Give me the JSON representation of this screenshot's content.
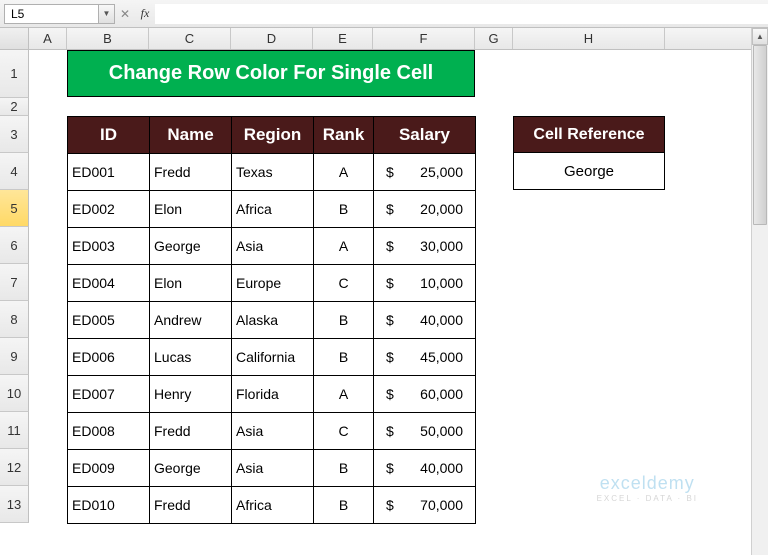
{
  "namebox": "L5",
  "formula": "",
  "columns": [
    "A",
    "B",
    "C",
    "D",
    "E",
    "F",
    "G",
    "H"
  ],
  "rows": [
    "1",
    "2",
    "3",
    "4",
    "5",
    "6",
    "7",
    "8",
    "9",
    "10",
    "11",
    "12",
    "13"
  ],
  "active_row": "5",
  "title": "Change Row Color For Single Cell",
  "headers": {
    "id": "ID",
    "name": "Name",
    "region": "Region",
    "rank": "Rank",
    "salary": "Salary"
  },
  "data": [
    {
      "id": "ED001",
      "name": "Fredd",
      "region": "Texas",
      "rank": "A",
      "salary": "25,000"
    },
    {
      "id": "ED002",
      "name": "Elon",
      "region": "Africa",
      "rank": "B",
      "salary": "20,000"
    },
    {
      "id": "ED003",
      "name": "George",
      "region": "Asia",
      "rank": "A",
      "salary": "30,000"
    },
    {
      "id": "ED004",
      "name": "Elon",
      "region": "Europe",
      "rank": "C",
      "salary": "10,000"
    },
    {
      "id": "ED005",
      "name": "Andrew",
      "region": "Alaska",
      "rank": "B",
      "salary": "40,000"
    },
    {
      "id": "ED006",
      "name": "Lucas",
      "region": "California",
      "rank": "B",
      "salary": "45,000"
    },
    {
      "id": "ED007",
      "name": "Henry",
      "region": "Florida",
      "rank": "A",
      "salary": "60,000"
    },
    {
      "id": "ED008",
      "name": "Fredd",
      "region": "Asia",
      "rank": "C",
      "salary": "50,000"
    },
    {
      "id": "ED009",
      "name": "George",
      "region": "Asia",
      "rank": "B",
      "salary": "40,000"
    },
    {
      "id": "ED010",
      "name": "Fredd",
      "region": "Africa",
      "rank": "B",
      "salary": "70,000"
    }
  ],
  "currency": "$",
  "ref": {
    "header": "Cell Reference",
    "value": "George"
  },
  "watermark": {
    "main": "exceldemy",
    "sub": "EXCEL · DATA · BI"
  }
}
